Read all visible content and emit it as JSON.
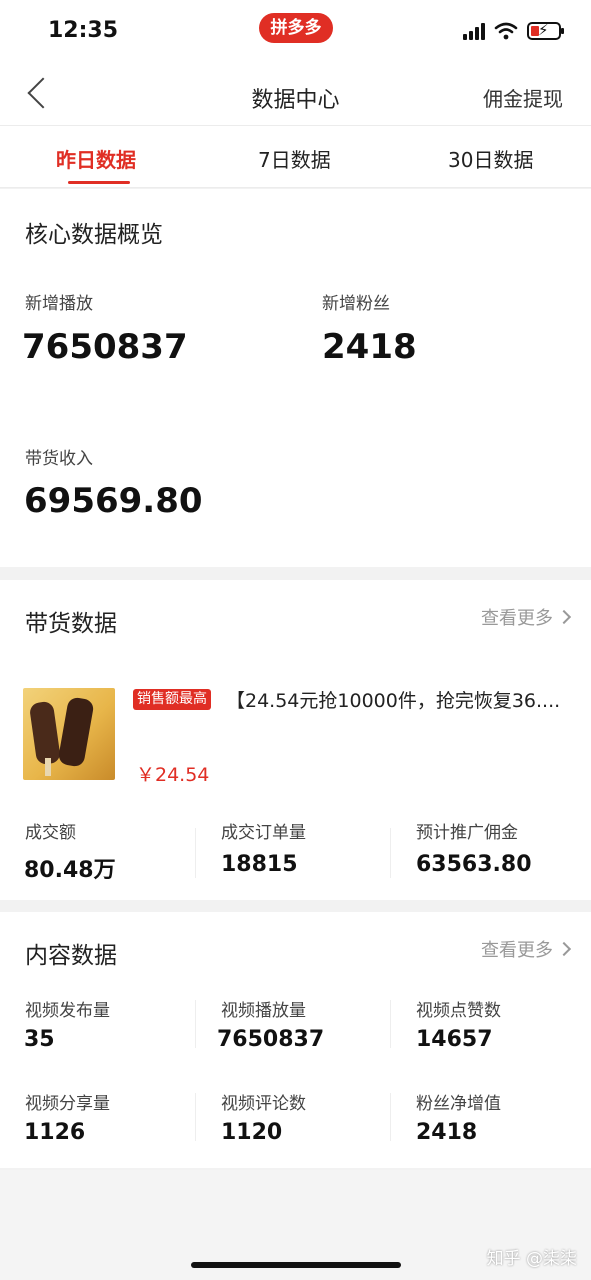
{
  "status_bar": {
    "time": "12:35",
    "app_badge": "拼多多"
  },
  "header": {
    "title": "数据中心",
    "right_action": "佣金提现"
  },
  "tabs": [
    {
      "label": "昨日数据",
      "active": true
    },
    {
      "label": "7日数据",
      "active": false
    },
    {
      "label": "30日数据",
      "active": false
    }
  ],
  "core": {
    "title": "核心数据概览",
    "metrics": [
      {
        "label": "新增播放",
        "value": "7650837"
      },
      {
        "label": "新增粉丝",
        "value": "2418"
      },
      {
        "label": "带货收入",
        "value": "69569.80"
      }
    ]
  },
  "goods": {
    "title": "带货数据",
    "more": "查看更多",
    "product": {
      "badge": "销售额最高",
      "title": "【24.54元抢10000件，抢完恢复36....",
      "price": "￥24.54"
    },
    "metrics": [
      {
        "label": "成交额",
        "value": "80.48万"
      },
      {
        "label": "成交订单量",
        "value": "18815"
      },
      {
        "label": "预计推广佣金",
        "value": "63563.80"
      }
    ]
  },
  "content": {
    "title": "内容数据",
    "more": "查看更多",
    "metrics": [
      {
        "label": "视频发布量",
        "value": "35"
      },
      {
        "label": "视频播放量",
        "value": "7650837"
      },
      {
        "label": "视频点赞数",
        "value": "14657"
      },
      {
        "label": "视频分享量",
        "value": "1126"
      },
      {
        "label": "视频评论数",
        "value": "1120"
      },
      {
        "label": "粉丝净增值",
        "value": "2418"
      }
    ]
  },
  "watermark": "知乎 @柒柒",
  "colors": {
    "accent": "#e02e24",
    "background": "#f2f2f2"
  }
}
